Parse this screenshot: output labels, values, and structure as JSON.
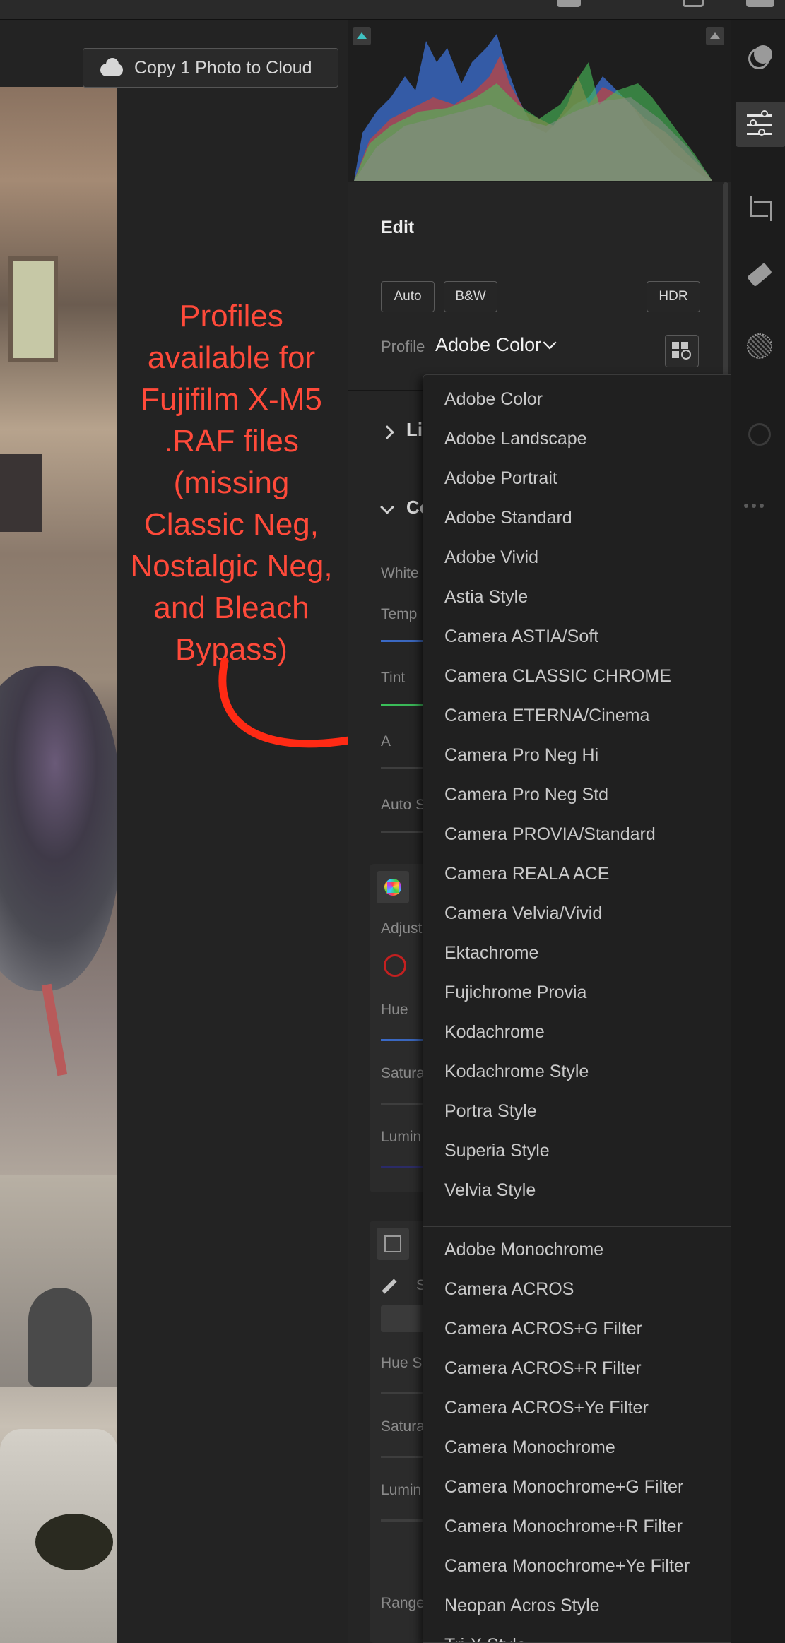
{
  "top_bar": {
    "icons": [
      "shield-icon",
      "help-icon",
      "menu-icon"
    ]
  },
  "photo_area": {
    "copy_button_label": "Copy 1 Photo to Cloud",
    "annotation_text": "Profiles available for Fujifilm X-M5 .RAF files (missing Classic Neg, Nostalgic Neg, and Bleach Bypass)",
    "annotation_color": "#ff4a3a"
  },
  "edit_panel": {
    "title": "Edit",
    "buttons": {
      "auto": "Auto",
      "bw": "B&W",
      "hdr": "HDR"
    },
    "profile": {
      "label": "Profile",
      "value": "Adobe Color"
    },
    "light_label_partial": "Li",
    "color_label_partial": "Co",
    "color_sub": {
      "white_balance": "White",
      "temp": "Temp",
      "tint": "Tint",
      "a_label": "A",
      "auto_s": "Auto S",
      "adjust": "Adjust",
      "hue": "Hue",
      "saturation": "Satura",
      "luminance": "Lumin"
    },
    "point_color": {
      "s_label": "S",
      "hue_shift": "Hue S",
      "saturation": "Satura",
      "luminance": "Lumin",
      "range": "Range"
    }
  },
  "profile_menu": {
    "color_profiles": [
      "Adobe Color",
      "Adobe Landscape",
      "Adobe Portrait",
      "Adobe Standard",
      "Adobe Vivid",
      "Astia Style",
      "Camera ASTIA/Soft",
      "Camera CLASSIC CHROME",
      "Camera ETERNA/Cinema",
      "Camera Pro Neg Hi",
      "Camera Pro Neg Std",
      "Camera PROVIA/Standard",
      "Camera REALA ACE",
      "Camera Velvia/Vivid",
      "Ektachrome",
      "Fujichrome Provia",
      "Kodachrome",
      "Kodachrome Style",
      "Portra Style",
      "Superia Style",
      "Velvia Style"
    ],
    "monochrome_profiles": [
      "Adobe Monochrome",
      "Camera ACROS",
      "Camera ACROS+G Filter",
      "Camera ACROS+R Filter",
      "Camera ACROS+Ye Filter",
      "Camera Monochrome",
      "Camera Monochrome+G Filter",
      "Camera Monochrome+R Filter",
      "Camera Monochrome+Ye Filter",
      "Neopan Acros Style",
      "Tri-X Style"
    ]
  },
  "toolbar": {
    "tools": [
      "heal-mask-icon",
      "edit-sliders-icon",
      "crop-icon",
      "eraser-icon",
      "masking-icon",
      "history-icon",
      "more-icon"
    ],
    "active_tool": "edit-sliders-icon"
  },
  "colors": {
    "accent_teal": "#3fc2c2",
    "panel_bg": "#252525",
    "menu_bg": "#202020"
  }
}
